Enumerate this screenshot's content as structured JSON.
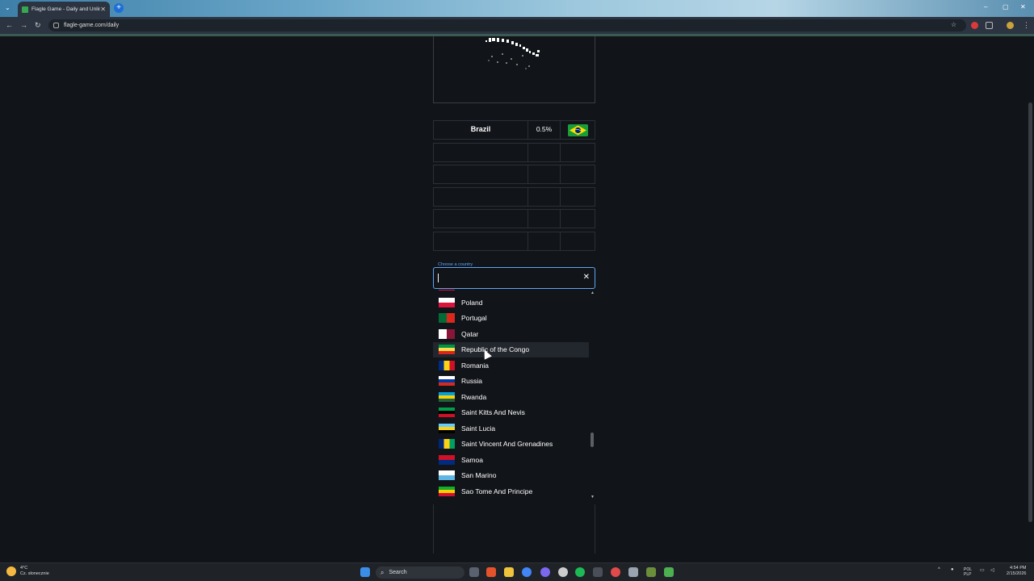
{
  "browser": {
    "tab_title": "Flagle Game - Daily and Unlimi",
    "url": "flagle-game.com/daily"
  },
  "game": {
    "guesses": [
      {
        "country": "Brazil",
        "percent": "0.5%",
        "flag_icon": "brazil-flag-icon"
      }
    ],
    "input_label": "Choose a country",
    "input_value": "",
    "clear_symbol": "✕"
  },
  "dropdown": {
    "options": [
      {
        "label": "Poland",
        "flag": [
          "#ffffff",
          "#dc143c"
        ]
      },
      {
        "label": "Portugal",
        "flag": [
          "#046a38",
          "#da291c"
        ]
      },
      {
        "label": "Qatar",
        "flag": [
          "#ffffff",
          "#8a1538"
        ]
      },
      {
        "label": "Republic of the Congo",
        "flag": [
          "#009543",
          "#fbde4a",
          "#dc241f"
        ]
      },
      {
        "label": "Romania",
        "flag": [
          "#002b7f",
          "#fcd116",
          "#ce1126"
        ]
      },
      {
        "label": "Russia",
        "flag": [
          "#ffffff",
          "#0039a6",
          "#d52b1e"
        ]
      },
      {
        "label": "Rwanda",
        "flag": [
          "#00a1de",
          "#fad201",
          "#20603d"
        ]
      },
      {
        "label": "Saint Kitts And Nevis",
        "flag": [
          "#009e49",
          "#000000",
          "#ce1126"
        ]
      },
      {
        "label": "Saint Lucia",
        "flag": [
          "#66ccff",
          "#fcd116",
          "#000000"
        ]
      },
      {
        "label": "Saint Vincent And Grenadines",
        "flag": [
          "#002674",
          "#fcd116",
          "#009e60"
        ]
      },
      {
        "label": "Samoa",
        "flag": [
          "#ce1126",
          "#002b7f"
        ]
      },
      {
        "label": "San Marino",
        "flag": [
          "#ffffff",
          "#5eb6e4"
        ]
      },
      {
        "label": "Sao Tome And Principe",
        "flag": [
          "#12ad2b",
          "#ffce00",
          "#d21034"
        ]
      }
    ],
    "hovered_index": 3
  },
  "taskbar": {
    "weather_temp": "4°C",
    "weather_desc": "Cz. słonecznie",
    "search_label": "Search",
    "lang_top": "POL",
    "lang_bottom": "PLP",
    "time": "4:54 PM",
    "date": "2/15/2026"
  }
}
